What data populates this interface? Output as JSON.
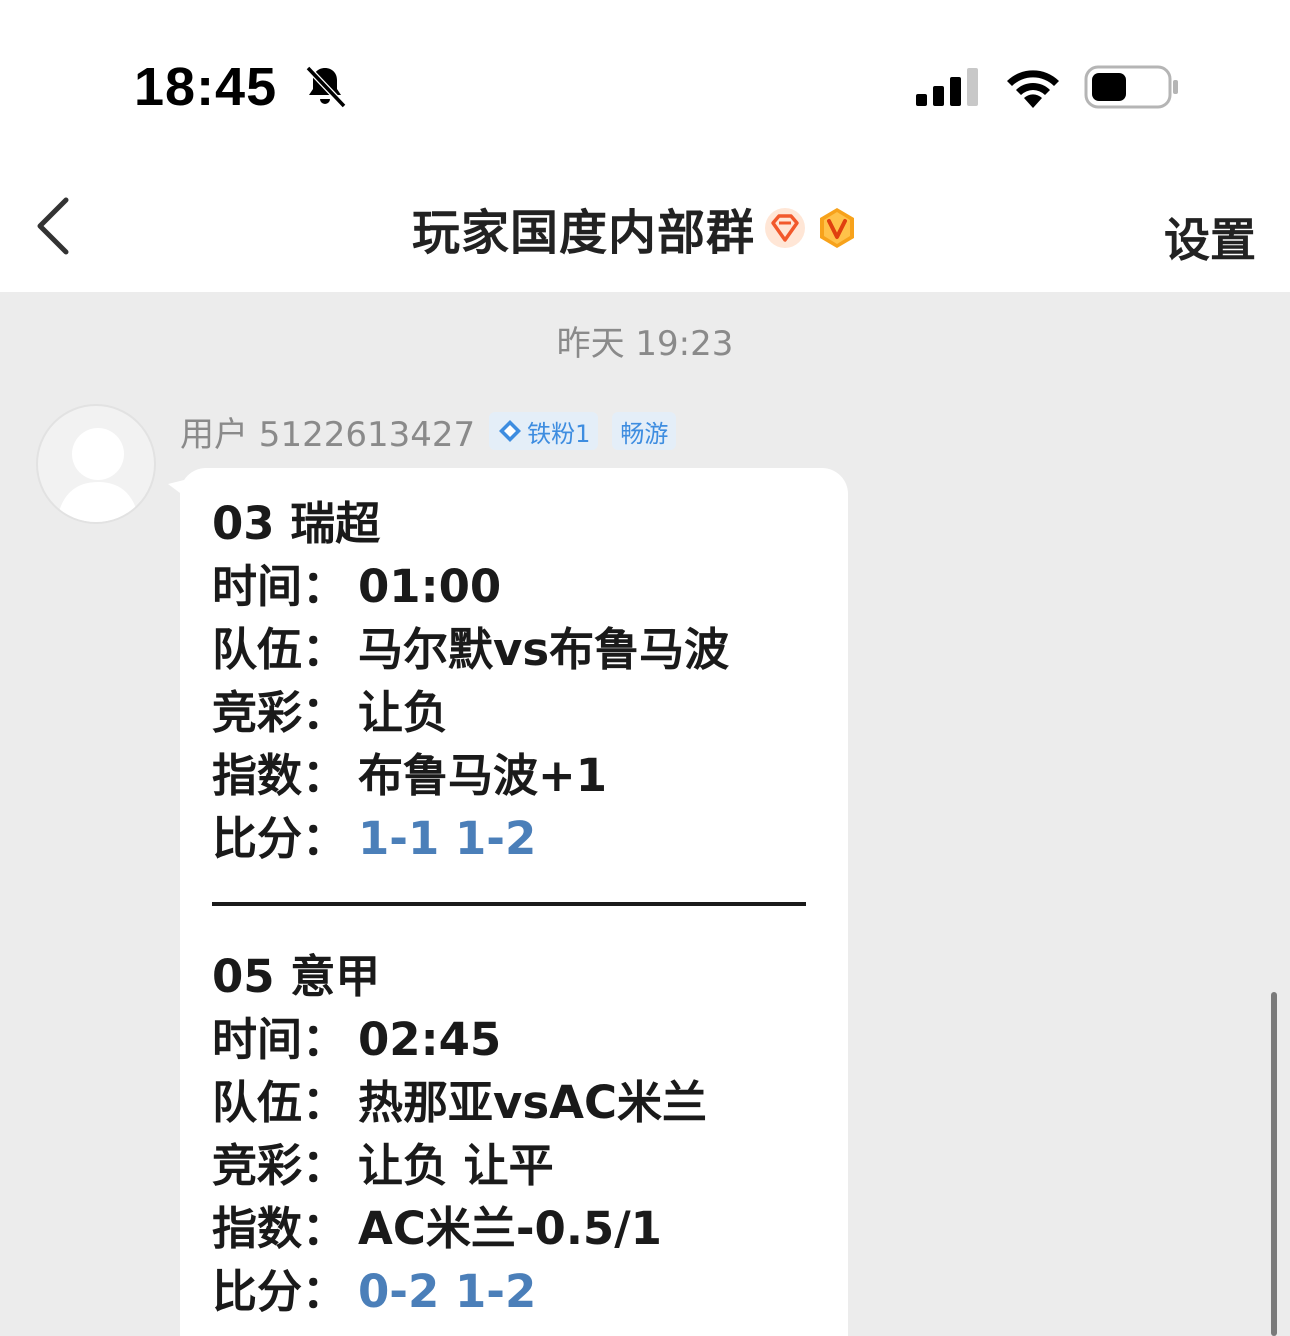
{
  "status_bar": {
    "time": "18:45"
  },
  "header": {
    "title": "玩家国度内部群",
    "settings_label": "设置"
  },
  "chat": {
    "date_separator": "昨天 19:23",
    "message": {
      "sender": "用户 5122613427",
      "tags": [
        "铁粉1",
        "畅游"
      ],
      "matches": [
        {
          "heading": "03 瑞超",
          "time_label": "时间：",
          "time": "01:00",
          "team_label": "队伍：",
          "team": "马尔默vs布鲁马波",
          "pick_label": "竞彩：",
          "pick": "让负",
          "index_label": "指数：",
          "index": "布鲁马波+1",
          "score_label": "比分：",
          "scores": "1-1 1-2"
        },
        {
          "heading": "05 意甲",
          "time_label": "时间：",
          "time": "02:45",
          "team_label": "队伍：",
          "team": "热那亚vsAC米兰",
          "pick_label": "竞彩：",
          "pick": "让负 让平",
          "index_label": "指数：",
          "index": "AC米兰-0.5/1",
          "score_label": "比分：",
          "scores": "0-2 1-2"
        }
      ]
    }
  },
  "colors": {
    "background": "#ececec",
    "score_link": "#4b7fb9",
    "tag_text": "#3e8de0",
    "tag_bg": "#e4eef8"
  }
}
